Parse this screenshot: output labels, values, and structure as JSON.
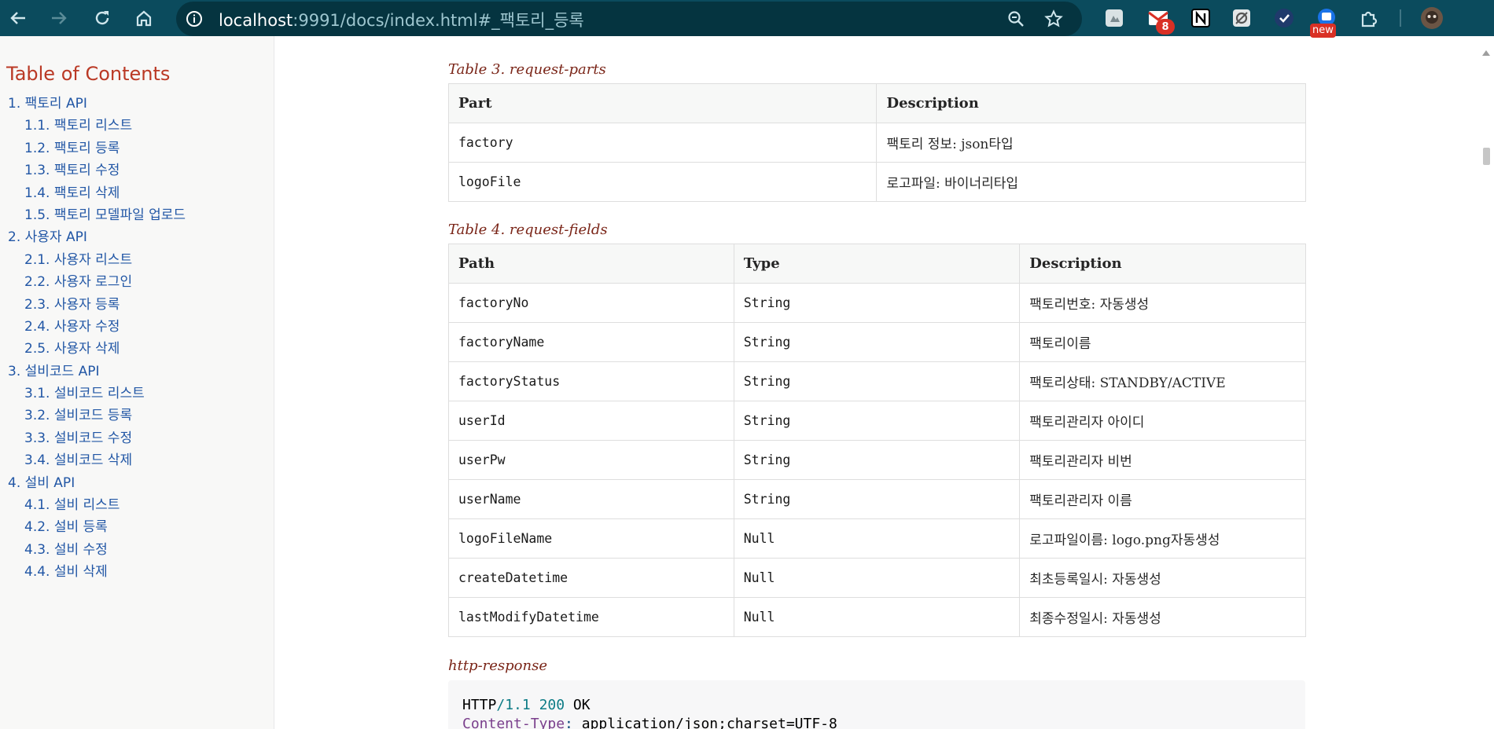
{
  "browser": {
    "url_host": "localhost",
    "url_rest": ":9991/docs/index.html#_팩토리_등록",
    "extensions": [
      {
        "name": "puzzle-piece-ext",
        "badge": ""
      },
      {
        "name": "gmail-ext",
        "badge": "8"
      },
      {
        "name": "notion-ext",
        "badge": ""
      },
      {
        "name": "image-ext",
        "badge": ""
      },
      {
        "name": "check-ext",
        "badge": ""
      },
      {
        "name": "notes-ext",
        "badge": "new"
      }
    ],
    "colors": {
      "toolbar": "#0b4b5d",
      "omnibox": "#053440"
    }
  },
  "sidebar": {
    "title": "Table of Contents",
    "items": [
      {
        "label": "1. 팩토리 API",
        "level": 1
      },
      {
        "label": "1.1. 팩토리 리스트",
        "level": 2
      },
      {
        "label": "1.2. 팩토리 등록",
        "level": 2
      },
      {
        "label": "1.3. 팩토리 수정",
        "level": 2
      },
      {
        "label": "1.4. 팩토리 삭제",
        "level": 2
      },
      {
        "label": "1.5. 팩토리 모델파일 업로드",
        "level": 2
      },
      {
        "label": "2. 사용자 API",
        "level": 1
      },
      {
        "label": "2.1. 사용자 리스트",
        "level": 2
      },
      {
        "label": "2.2. 사용자 로그인",
        "level": 2
      },
      {
        "label": "2.3. 사용자 등록",
        "level": 2
      },
      {
        "label": "2.4. 사용자 수정",
        "level": 2
      },
      {
        "label": "2.5. 사용자 삭제",
        "level": 2
      },
      {
        "label": "3. 설비코드 API",
        "level": 1
      },
      {
        "label": "3.1. 설비코드 리스트",
        "level": 2
      },
      {
        "label": "3.2. 설비코드 등록",
        "level": 2
      },
      {
        "label": "3.3. 설비코드 수정",
        "level": 2
      },
      {
        "label": "3.4. 설비코드 삭제",
        "level": 2
      },
      {
        "label": "4. 설비 API",
        "level": 1
      },
      {
        "label": "4.1. 설비 리스트",
        "level": 2
      },
      {
        "label": "4.2. 설비 등록",
        "level": 2
      },
      {
        "label": "4.3. 설비 수정",
        "level": 2
      },
      {
        "label": "4.4. 설비 삭제",
        "level": 2
      }
    ]
  },
  "content": {
    "table3": {
      "caption": "Table 3. request-parts",
      "headers": [
        "Part",
        "Description"
      ],
      "rows": [
        [
          "factory",
          "팩토리 정보: json타입"
        ],
        [
          "logoFile",
          "로고파일: 바이너리타입"
        ]
      ]
    },
    "table4": {
      "caption": "Table 4. request-fields",
      "headers": [
        "Path",
        "Type",
        "Description"
      ],
      "rows": [
        [
          "factoryNo",
          "String",
          "팩토리번호: 자동생성"
        ],
        [
          "factoryName",
          "String",
          "팩토리이름"
        ],
        [
          "factoryStatus",
          "String",
          "팩토리상태: STANDBY/ACTIVE"
        ],
        [
          "userId",
          "String",
          "팩토리관리자 아이디"
        ],
        [
          "userPw",
          "String",
          "팩토리관리자 비번"
        ],
        [
          "userName",
          "String",
          "팩토리관리자 이름"
        ],
        [
          "logoFileName",
          "Null",
          "로고파일이름: logo.png자동생성"
        ],
        [
          "createDatetime",
          "Null",
          "최초등록일시: 자동생성"
        ],
        [
          "lastModifyDatetime",
          "Null",
          "최종수정일시: 자동생성"
        ]
      ]
    },
    "response": {
      "caption": "http-response",
      "line1": {
        "proto": "HTTP",
        "slash": "/",
        "version": "1.1",
        "status": "200",
        "text": "OK"
      },
      "line2": {
        "key": "Content-Type",
        "colon": ":",
        "value": "application/json;charset=UTF-8"
      }
    }
  }
}
